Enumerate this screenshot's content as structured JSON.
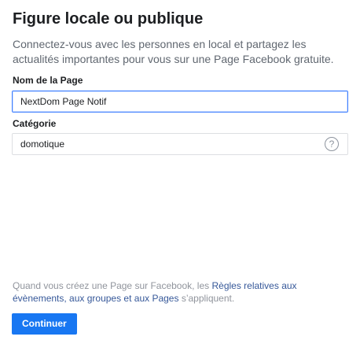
{
  "page": {
    "title": "Figure locale ou publique",
    "description": "Connectez-vous avec les personnes en local et partagez les actualités importantes pour vous sur une Page Facebook gratuite."
  },
  "form": {
    "page_name_label": "Nom de la Page",
    "page_name_value": "NextDom Page Notif",
    "category_label": "Catégorie",
    "category_value": "domotique",
    "help_icon_glyph": "?",
    "help_icon": "question-circle-icon"
  },
  "footer": {
    "note_prefix": "Quand vous créez une Page sur Facebook, les ",
    "note_link": "Règles relatives aux évènements, aux groupes et aux Pages",
    "note_suffix": " s’appliquent.",
    "continue_label": "Continuer"
  },
  "colors": {
    "accent": "#1877f2",
    "link": "#365899",
    "focus_border": "#4080ff"
  }
}
